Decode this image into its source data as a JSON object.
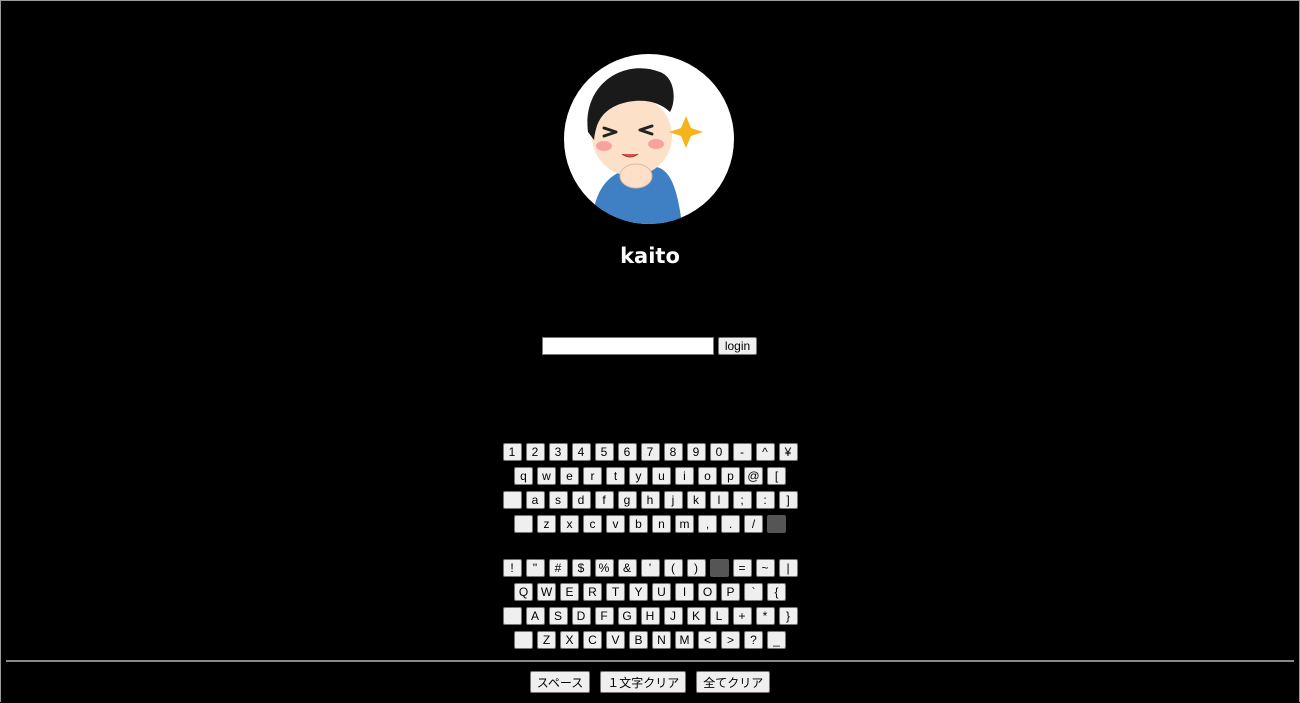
{
  "user": {
    "name": "kaito"
  },
  "login": {
    "password_value": "",
    "password_placeholder": "",
    "button_label": "login"
  },
  "keyboard": {
    "lower_rows": [
      [
        "1",
        "2",
        "3",
        "4",
        "5",
        "6",
        "7",
        "8",
        "9",
        "0",
        "-",
        "^",
        "¥"
      ],
      [
        "q",
        "w",
        "e",
        "r",
        "t",
        "y",
        "u",
        "i",
        "o",
        "p",
        "@",
        "["
      ],
      [
        " ",
        "a",
        "s",
        "d",
        "f",
        "g",
        "h",
        "j",
        "k",
        "l",
        ";",
        ":",
        "]"
      ],
      [
        " ",
        "z",
        "x",
        "c",
        "v",
        "b",
        "n",
        "m",
        ",",
        ".",
        "/",
        ""
      ]
    ],
    "upper_rows": [
      [
        "!",
        "\"",
        "#",
        "$",
        "%",
        "&",
        "'",
        "(",
        ")",
        "",
        "=",
        "~",
        "|"
      ],
      [
        "Q",
        "W",
        "E",
        "R",
        "T",
        "Y",
        "U",
        "I",
        "O",
        "P",
        "`",
        "{"
      ],
      [
        " ",
        "A",
        "S",
        "D",
        "F",
        "G",
        "H",
        "J",
        "K",
        "L",
        "+",
        "*",
        "}"
      ],
      [
        " ",
        "Z",
        "X",
        "C",
        "V",
        "B",
        "N",
        "M",
        "<",
        ">",
        "?",
        "_"
      ]
    ],
    "dark_keys": [
      {
        "group": "lower_rows",
        "row": 3,
        "col": 11
      },
      {
        "group": "upper_rows",
        "row": 0,
        "col": 9
      }
    ]
  },
  "actions": {
    "space_label": "スペース",
    "backspace_label": "１文字クリア",
    "clear_all_label": "全てクリア"
  },
  "colors": {
    "background": "#000000",
    "key_face": "#efefef",
    "dark_key": "#555555",
    "shirt": "#3f7fc4",
    "sparkle": "#f5b41e"
  }
}
